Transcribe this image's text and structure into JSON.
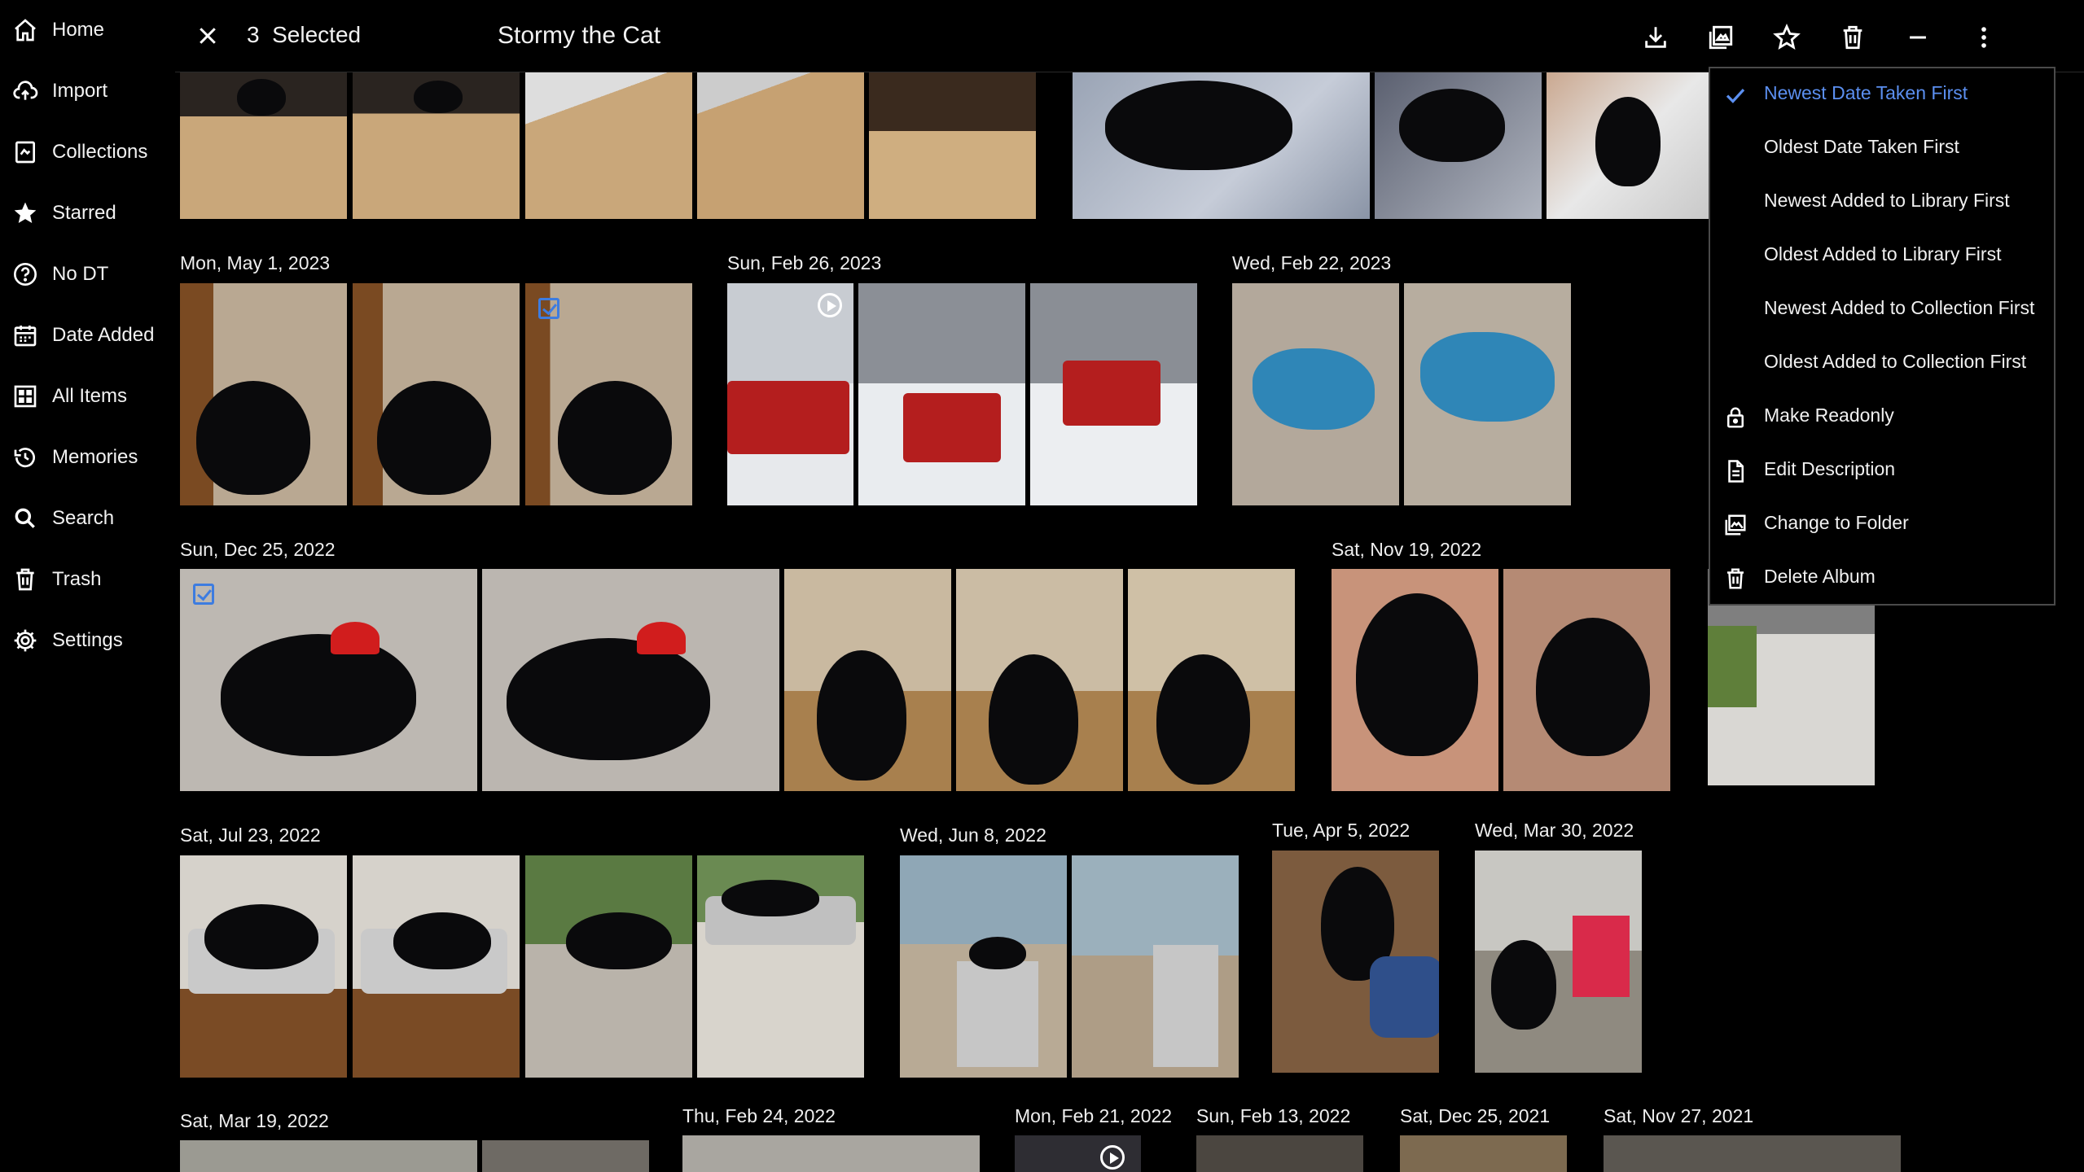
{
  "sidebar": {
    "items": [
      {
        "label": "Home",
        "icon": "home-icon"
      },
      {
        "label": "Import",
        "icon": "cloud-upload-icon"
      },
      {
        "label": "Collections",
        "icon": "collections-icon"
      },
      {
        "label": "Starred",
        "icon": "star-icon"
      },
      {
        "label": "No DT",
        "icon": "question-circle-icon"
      },
      {
        "label": "Date Added",
        "icon": "calendar-icon"
      },
      {
        "label": "All Items",
        "icon": "grid-icon"
      },
      {
        "label": "Memories",
        "icon": "history-icon"
      },
      {
        "label": "Search",
        "icon": "search-icon"
      },
      {
        "label": "Trash",
        "icon": "trash-icon"
      },
      {
        "label": "Settings",
        "icon": "gear-icon"
      }
    ]
  },
  "header": {
    "selected_label": "3  Selected",
    "album_title": "Stormy the Cat",
    "actions": [
      "download-icon",
      "add-to-collection-icon",
      "star-icon",
      "trash-icon",
      "minimize-icon",
      "more-vert-icon"
    ]
  },
  "gallery": {
    "groups": [
      {
        "date": "Mon, May 1, 2023"
      },
      {
        "date": "Sun, Feb 26, 2023"
      },
      {
        "date": "Wed, Feb 22, 2023"
      },
      {
        "date": "Sun, Dec 25, 2022"
      },
      {
        "date": "Sat, Nov 19, 2022"
      },
      {
        "date": "Sat, Jul 23, 2022"
      },
      {
        "date": "Wed, Jun 8, 2022"
      },
      {
        "date": "Tue, Apr 5, 2022"
      },
      {
        "date": "Wed, Mar 30, 2022"
      },
      {
        "date": "Sat, Mar 19, 2022"
      },
      {
        "date": "Thu, Feb 24, 2022"
      },
      {
        "date": "Mon, Feb 21, 2022"
      },
      {
        "date": "Sun, Feb 13, 2022"
      },
      {
        "date": "Sat, Dec 25, 2021"
      },
      {
        "date": "Sat, Nov 27, 2021"
      }
    ]
  },
  "sort_menu": {
    "items": [
      {
        "label": "Newest Date Taken First",
        "active": true,
        "icon": "check-icon"
      },
      {
        "label": "Oldest Date Taken First"
      },
      {
        "label": "Newest Added to Library First"
      },
      {
        "label": "Oldest Added to Library First"
      },
      {
        "label": "Newest Added to Collection First"
      },
      {
        "label": "Oldest Added to Collection First"
      },
      {
        "label": "Make Readonly",
        "icon": "lock-icon"
      },
      {
        "label": "Edit Description",
        "icon": "document-icon"
      },
      {
        "label": "Change to Folder",
        "icon": "folder-images-icon"
      },
      {
        "label": "Delete Album",
        "icon": "trash-icon"
      }
    ]
  },
  "colors": {
    "background": "#000000",
    "accent": "#5b8ff0",
    "text": "#f2f2f2"
  }
}
